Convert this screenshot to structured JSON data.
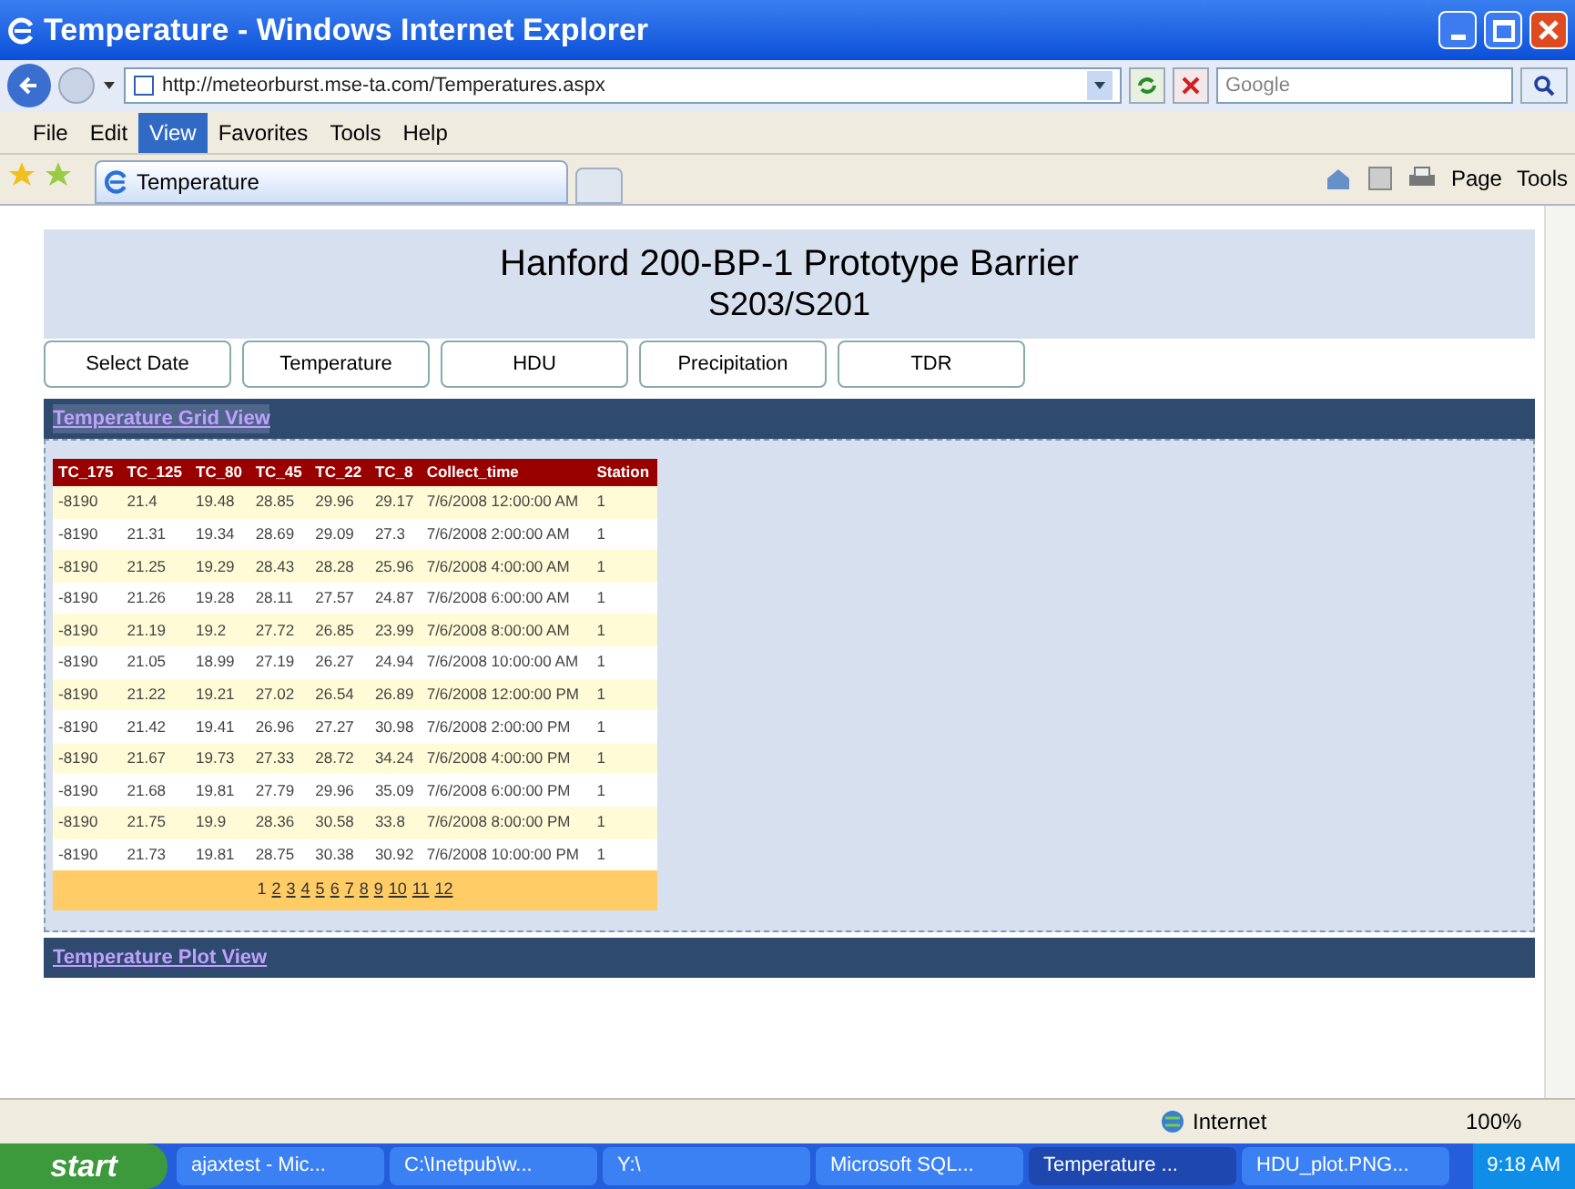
{
  "window": {
    "title": "Temperature - Windows Internet Explorer"
  },
  "address_bar": {
    "url": "http://meteorburst.mse-ta.com/Temperatures.aspx"
  },
  "search": {
    "placeholder": "Google"
  },
  "menu": [
    {
      "label": "File",
      "selected": false
    },
    {
      "label": "Edit",
      "selected": false
    },
    {
      "label": "View",
      "selected": true
    },
    {
      "label": "Favorites",
      "selected": false
    },
    {
      "label": "Tools",
      "selected": false
    },
    {
      "label": "Help",
      "selected": false
    }
  ],
  "tab": {
    "label": "Temperature"
  },
  "command_bar": [
    "Page",
    "Tools"
  ],
  "page": {
    "title": "Hanford 200-BP-1 Prototype Barrier",
    "subtitle": "S203/S201",
    "buttons": [
      "Select Date",
      "Temperature",
      "HDU",
      "Precipitation",
      "TDR"
    ],
    "grid_section": "Temperature Grid View",
    "table": {
      "columns": [
        "TC_175",
        "TC_125",
        "TC_80",
        "TC_45",
        "TC_22",
        "TC_8",
        "Collect_time",
        "Station"
      ],
      "rows": [
        [
          "-8190",
          "21.4",
          "19.48",
          "28.85",
          "29.96",
          "29.17",
          "7/6/2008 12:00:00 AM",
          "1"
        ],
        [
          "-8190",
          "21.31",
          "19.34",
          "28.69",
          "29.09",
          "27.3",
          "7/6/2008 2:00:00 AM",
          "1"
        ],
        [
          "-8190",
          "21.25",
          "19.29",
          "28.43",
          "28.28",
          "25.96",
          "7/6/2008 4:00:00 AM",
          "1"
        ],
        [
          "-8190",
          "21.26",
          "19.28",
          "28.11",
          "27.57",
          "24.87",
          "7/6/2008 6:00:00 AM",
          "1"
        ],
        [
          "-8190",
          "21.19",
          "19.2",
          "27.72",
          "26.85",
          "23.99",
          "7/6/2008 8:00:00 AM",
          "1"
        ],
        [
          "-8190",
          "21.05",
          "18.99",
          "27.19",
          "26.27",
          "24.94",
          "7/6/2008 10:00:00 AM",
          "1"
        ],
        [
          "-8190",
          "21.22",
          "19.21",
          "27.02",
          "26.54",
          "26.89",
          "7/6/2008 12:00:00 PM",
          "1"
        ],
        [
          "-8190",
          "21.42",
          "19.41",
          "26.96",
          "27.27",
          "30.98",
          "7/6/2008 2:00:00 PM",
          "1"
        ],
        [
          "-8190",
          "21.67",
          "19.73",
          "27.33",
          "28.72",
          "34.24",
          "7/6/2008 4:00:00 PM",
          "1"
        ],
        [
          "-8190",
          "21.68",
          "19.81",
          "27.79",
          "29.96",
          "35.09",
          "7/6/2008 6:00:00 PM",
          "1"
        ],
        [
          "-8190",
          "21.75",
          "19.9",
          "28.36",
          "30.58",
          "33.8",
          "7/6/2008 8:00:00 PM",
          "1"
        ],
        [
          "-8190",
          "21.73",
          "19.81",
          "28.75",
          "30.38",
          "30.92",
          "7/6/2008 10:00:00 PM",
          "1"
        ]
      ],
      "pages": [
        {
          "label": "1",
          "selected": true
        },
        {
          "label": "2",
          "selected": false
        },
        {
          "label": "3",
          "selected": false
        },
        {
          "label": "4",
          "selected": false
        },
        {
          "label": "5",
          "selected": false
        },
        {
          "label": "6",
          "selected": false
        },
        {
          "label": "7",
          "selected": false
        },
        {
          "label": "8",
          "selected": false
        },
        {
          "label": "9",
          "selected": false
        },
        {
          "label": "10",
          "selected": false
        },
        {
          "label": "11",
          "selected": false
        },
        {
          "label": "12",
          "selected": false
        }
      ]
    },
    "plot_section": "Temperature Plot View"
  },
  "status_bar": {
    "zone": "Internet",
    "zoom": "100%"
  },
  "taskbar": {
    "start": "start",
    "tasks": [
      {
        "label": "ajaxtest - Mic...",
        "selected": false
      },
      {
        "label": "C:\\Inetpub\\w...",
        "selected": false
      },
      {
        "label": "Y:\\",
        "selected": false
      },
      {
        "label": "Microsoft SQL...",
        "selected": false
      },
      {
        "label": "Temperature ...",
        "selected": true
      },
      {
        "label": "HDU_plot.PNG...",
        "selected": false
      }
    ],
    "clock": "9:18 AM"
  }
}
